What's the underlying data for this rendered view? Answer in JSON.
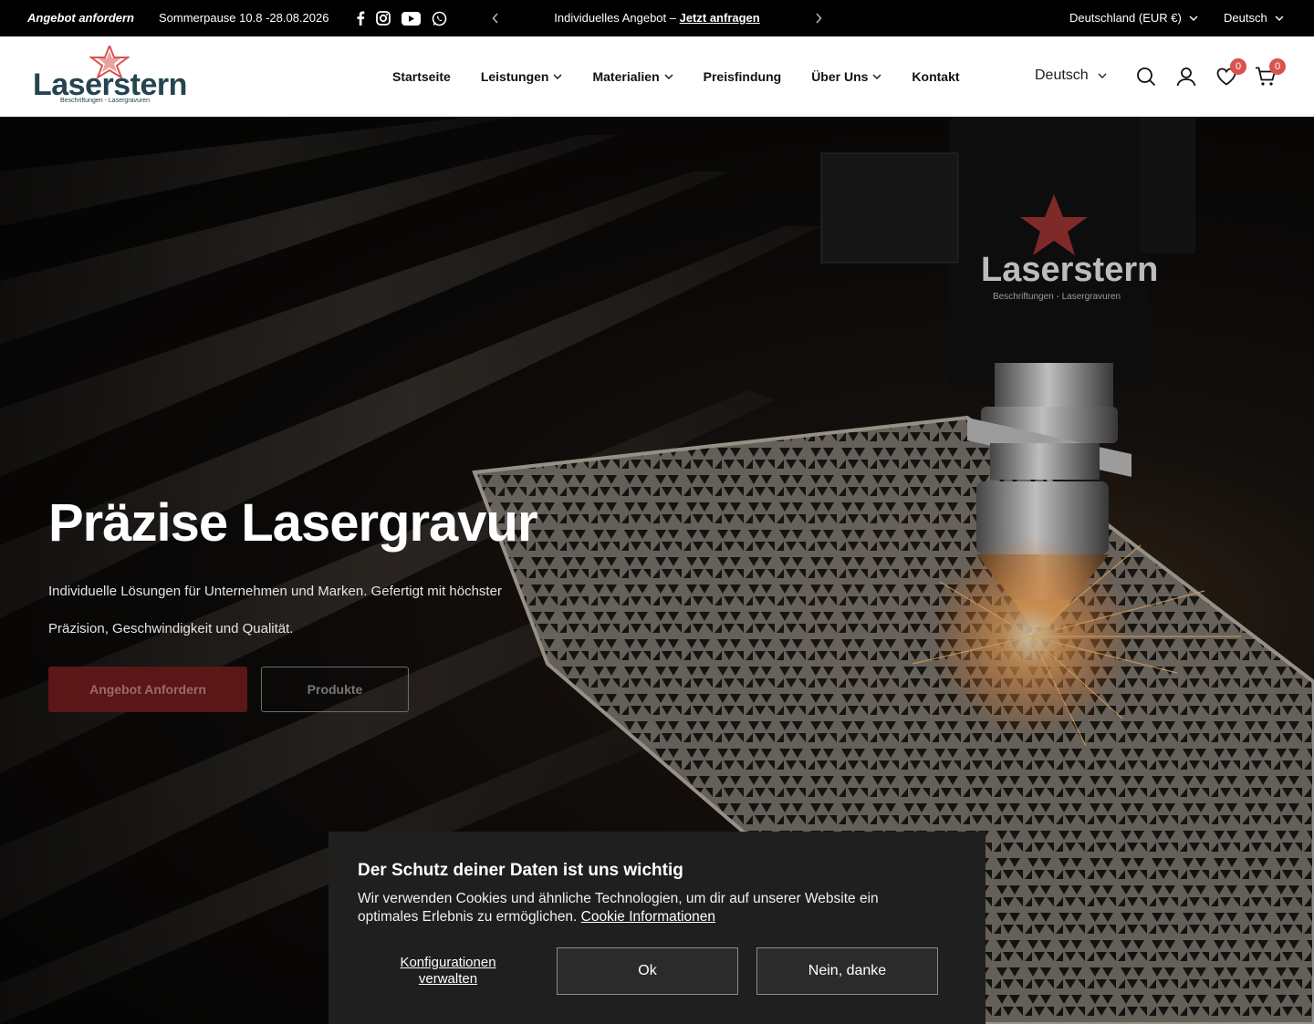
{
  "topbar": {
    "quote_link": "Angebot anfordern",
    "holiday_notice": "Sommerpause 10.8 -28.08.2026",
    "promo_text": "Individuelles Angebot – ",
    "promo_link": "Jetzt anfragen",
    "country_selector": "Deutschland (EUR €)",
    "language_selector": "Deutsch",
    "socials": [
      "facebook-icon",
      "instagram-icon",
      "youtube-icon",
      "whatsapp-icon"
    ]
  },
  "header": {
    "logo_wordmark": "Laserstern",
    "logo_tagline": "Beschriftungen - Lasergravuren",
    "nav": [
      {
        "label": "Startseite",
        "dropdown": false
      },
      {
        "label": "Leistungen",
        "dropdown": true
      },
      {
        "label": "Materialien",
        "dropdown": true
      },
      {
        "label": "Preisfindung",
        "dropdown": false
      },
      {
        "label": "Über Uns",
        "dropdown": true
      },
      {
        "label": "Kontakt",
        "dropdown": false
      }
    ],
    "language": "Deutsch",
    "wishlist_count": "0",
    "cart_count": "0"
  },
  "hero": {
    "title": "Präzise Lasergravur",
    "subtitle": "Individuelle Lösungen für Unternehmen und Marken. Gefertigt mit höchster Präzision, Geschwindigkeit und Qualität.",
    "primary_button": "Angebot Anfordern",
    "secondary_button": "Produkte",
    "machine_brand": "Laserstern",
    "machine_tagline": "Beschriftungen - Lasergravuren"
  },
  "cookie": {
    "title": "Der Schutz deiner Daten ist uns wichtig",
    "text": "Wir verwenden Cookies und ähnliche Technologien, um dir auf unserer Website ein optimales Erlebnis zu ermöglichen. ",
    "link": "Cookie Informationen",
    "configure": "Konfigurationen verwalten",
    "accept": "Ok",
    "decline": "Nein, danke"
  },
  "colors": {
    "brand_red": "#d9534f",
    "brand_teal": "#24454f",
    "primary_button": "#5b1617"
  }
}
